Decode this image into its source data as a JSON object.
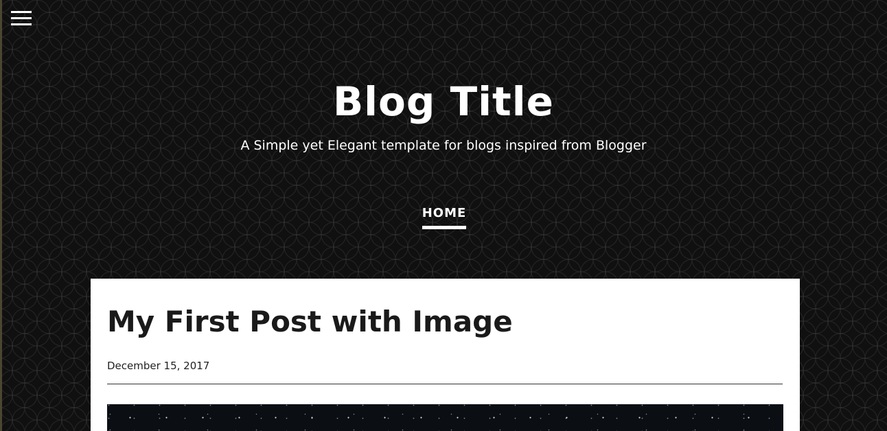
{
  "header": {
    "menu_icon": "hamburger-menu-icon",
    "title": "Blog Title",
    "subtitle": "A Simple yet Elegant template for blogs inspired from Blogger"
  },
  "nav": {
    "items": [
      {
        "label": "HOME",
        "active": true
      }
    ]
  },
  "post": {
    "title": "My First Post with Image",
    "date": "December 15, 2017",
    "image_description": "starry night sky"
  },
  "colors": {
    "background": "#101010",
    "card": "#ffffff",
    "text_light": "#ffffff",
    "text_dark": "#1a1a1a"
  }
}
